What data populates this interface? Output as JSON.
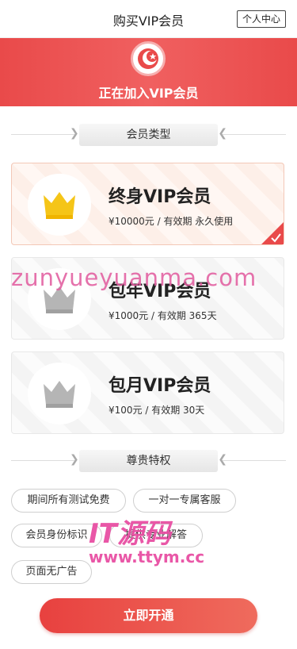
{
  "header": {
    "title": "购买VIP会员",
    "personal_center": "个人中心"
  },
  "banner": {
    "status_text": "正在加入VIP会员"
  },
  "membership_section": {
    "title": "会员类型"
  },
  "plans": [
    {
      "name": "终身VIP会员",
      "price_text": "¥10000元 / 有效期 永久使用",
      "crown_color": "#f5c518",
      "selected": true
    },
    {
      "name": "包年VIP会员",
      "price_text": "¥1000元 / 有效期 365天",
      "crown_color": "#b5b5b5",
      "selected": false
    },
    {
      "name": "包月VIP会员",
      "price_text": "¥100元 / 有效期 30天",
      "crown_color": "#b5b5b5",
      "selected": false
    }
  ],
  "privileges_section": {
    "title": "尊贵特权"
  },
  "privileges": [
    "期间所有测试免费",
    "一对一专属客服",
    "会员身份标识",
    "提供专业解答",
    "页面无广告"
  ],
  "cta": {
    "label": "立即开通"
  },
  "watermarks": {
    "top": "zunyueyuanma.com",
    "logo": "IT源码",
    "url": "www.ttym.cc"
  },
  "colors": {
    "accent": "#e94a4a",
    "gold": "#f5c518",
    "gray_crown": "#b5b5b5"
  }
}
